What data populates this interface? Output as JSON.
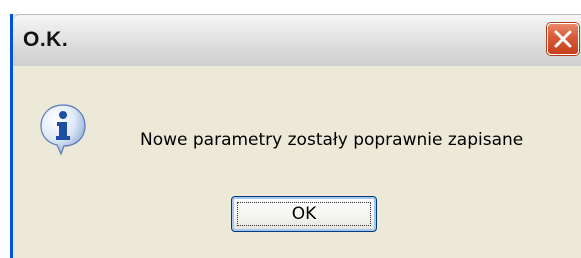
{
  "dialog": {
    "title": "O.K.",
    "message": "Nowe parametry zostały poprawnie zapisane",
    "ok_label": "OK",
    "icon": "info-icon",
    "close_icon": "close-icon"
  },
  "colors": {
    "window_border": "#0054e3",
    "dialog_background": "#ece9d8",
    "close_button": "#d85c39",
    "button_border": "#003c74"
  }
}
